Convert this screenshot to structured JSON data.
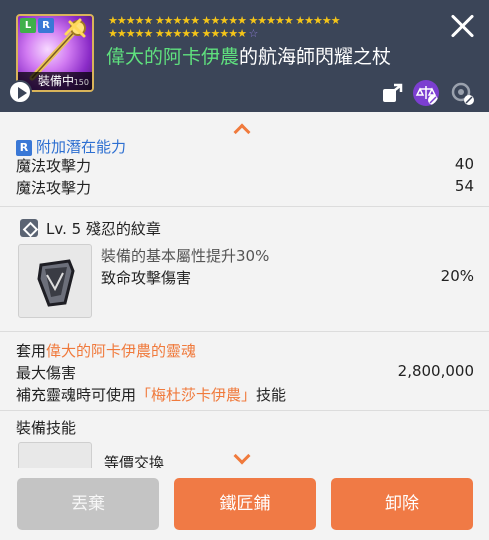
{
  "header": {
    "thumb": {
      "badge_l": "L",
      "badge_r": "R",
      "equipped_label": "裝備中",
      "level_text": "150"
    },
    "stars_row1": [
      "★★★★★",
      "★★★★★",
      "★★★★★",
      "★★★★★",
      "★★★★★"
    ],
    "stars_row2": [
      "★★★★★",
      "★★★★★",
      "★★★★★"
    ],
    "stars_row2_empty": "☆",
    "item_name_prefix": "偉大的阿卡伊農",
    "item_name_suffix": "的航海師閃耀之杖",
    "icons": [
      "share-icon",
      "scale-icon",
      "lock-icon",
      "close-icon",
      "play-icon"
    ]
  },
  "additional_potential": {
    "chip": "R",
    "title": "附加潛在能力",
    "lines": [
      {
        "label": "魔法攻擊力",
        "value": "40"
      },
      {
        "label": "魔法攻擊力",
        "value": "54"
      }
    ]
  },
  "emblem": {
    "title": "Lv. 5 殘忍的紋章",
    "line1": "裝備的基本屬性提升30%",
    "line2_label": "致命攻擊傷害",
    "line2_value": "20%"
  },
  "soul": {
    "title_prefix": "套用",
    "title_name": "偉大的阿卡伊農的靈魂",
    "max_damage_label": "最大傷害",
    "max_damage_value": "2,800,000",
    "skill_prefix": "補充靈魂時可使用",
    "skill_name": "「梅杜莎卡伊農」",
    "skill_suffix": "技能"
  },
  "equip_skill": {
    "title": "裝備技能",
    "first_skill": "等價交換"
  },
  "footer": {
    "discard": "丟棄",
    "blacksmith": "鐵匠鋪",
    "unequip": "卸除"
  },
  "colors": {
    "header_bg": "#3b4558",
    "accent_orange": "#f07a45",
    "name_green": "#5fe07e",
    "section_blue": "#2d6fd1",
    "star_gold": "#f5c518"
  }
}
